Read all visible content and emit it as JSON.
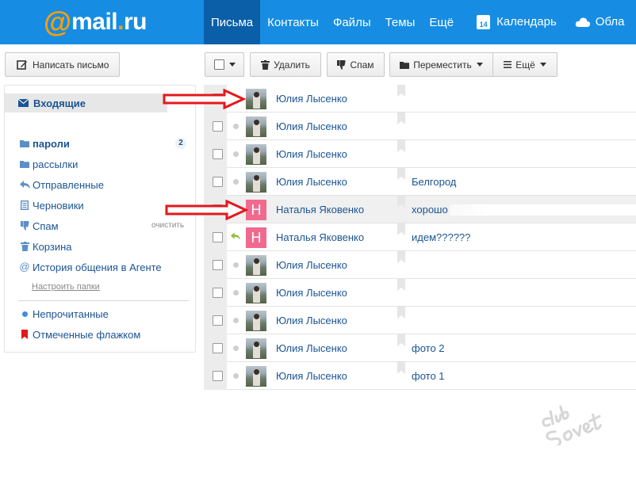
{
  "header": {
    "logo_at": "@",
    "logo_name": "mail",
    "logo_dot": ".",
    "logo_tld": "ru",
    "nav": [
      {
        "label": "Письма",
        "active": true
      },
      {
        "label": "Контакты",
        "active": false
      },
      {
        "label": "Файлы",
        "active": false
      },
      {
        "label": "Темы",
        "active": false
      },
      {
        "label": "Ещё",
        "active": false
      }
    ],
    "calendar_day": "14",
    "calendar_label": "Календарь",
    "cloud_label": "Обла",
    "color": "#168de2",
    "active_color": "#0a5fa8",
    "accent": "#ff9e00"
  },
  "compose": {
    "label": "Написать письмо",
    "icon": "compose-icon"
  },
  "sidebar": {
    "inbox": {
      "label": "Входящие",
      "icon": "envelope-icon"
    },
    "folders": [
      {
        "label": "пароли",
        "icon": "folder-icon",
        "bold": true,
        "count": "2"
      },
      {
        "label": "рассылки",
        "icon": "folder-icon"
      },
      {
        "label": "Отправленные",
        "icon": "reply-icon"
      },
      {
        "label": "Черновики",
        "icon": "draft-icon"
      },
      {
        "label": "Спам",
        "icon": "thumb-down-icon",
        "action": "очистить"
      },
      {
        "label": "Корзина",
        "icon": "trash-icon"
      },
      {
        "label": "История общения в Агенте",
        "icon": "at-icon"
      }
    ],
    "setup_link": "Настроить папки",
    "filters": [
      {
        "label": "Непрочитанные",
        "icon": "unread-dot-icon"
      },
      {
        "label": "Отмеченные флажком",
        "icon": "red-flag-icon"
      }
    ]
  },
  "toolbar": {
    "delete": "Удалить",
    "spam": "Спам",
    "move": "Переместить",
    "more": "Ещё"
  },
  "messages": [
    {
      "sender": "Юлия Лысенко",
      "subject": "",
      "avatar": "photo",
      "status": "unread",
      "arrow": true,
      "hl": false
    },
    {
      "sender": "Юлия Лысенко",
      "subject": "",
      "avatar": "photo",
      "status": "read",
      "arrow": false,
      "hl": false
    },
    {
      "sender": "Юлия Лысенко",
      "subject": "",
      "avatar": "photo",
      "status": "read",
      "arrow": false,
      "hl": false
    },
    {
      "sender": "Юлия Лысенко",
      "subject": "Белгород",
      "avatar": "photo",
      "status": "read",
      "arrow": false,
      "hl": false
    },
    {
      "sender": "Наталья Яковенко",
      "subject": "хорошо",
      "avatar": "letter",
      "letter": "Н",
      "status": "read",
      "arrow": true,
      "hl": true,
      "blurred": true
    },
    {
      "sender": "Наталья Яковенко",
      "subject": "идем??????",
      "avatar": "letter",
      "letter": "Н",
      "status": "replied",
      "arrow": false,
      "hl": false
    },
    {
      "sender": "Юлия Лысенко",
      "subject": "",
      "avatar": "photo",
      "status": "read",
      "arrow": false,
      "hl": false
    },
    {
      "sender": "Юлия Лысенко",
      "subject": "",
      "avatar": "photo",
      "status": "read",
      "arrow": false,
      "hl": false
    },
    {
      "sender": "Юлия Лысенко",
      "subject": "",
      "avatar": "photo",
      "status": "read",
      "arrow": false,
      "hl": false
    },
    {
      "sender": "Юлия Лысенко",
      "subject": "фото 2",
      "avatar": "photo",
      "status": "read",
      "arrow": false,
      "hl": false
    },
    {
      "sender": "Юлия Лысенко",
      "subject": "фото 1",
      "avatar": "photo",
      "status": "read",
      "arrow": false,
      "hl": false
    }
  ],
  "watermark": {
    "line1": "club",
    "line2": "Sovet"
  },
  "colors": {
    "link": "#1a5493",
    "arrow": "#e3181c",
    "avatar_letter_bg": "#f06a8f"
  }
}
